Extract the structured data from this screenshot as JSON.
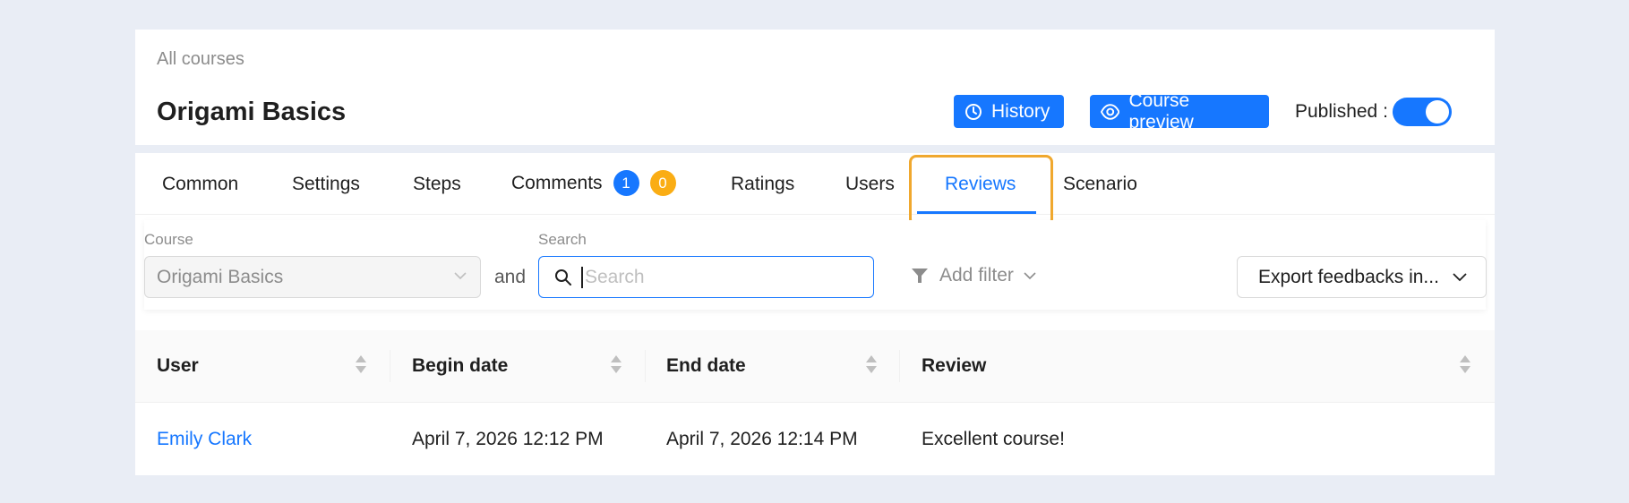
{
  "header": {
    "breadcrumb": "All courses",
    "title": "Origami Basics",
    "history_label": "History",
    "preview_label": "Course preview",
    "published_label": "Published :",
    "published": true
  },
  "tabs": [
    {
      "label": "Common"
    },
    {
      "label": "Settings"
    },
    {
      "label": "Steps"
    },
    {
      "label": "Comments",
      "badges": [
        "1",
        "0"
      ]
    },
    {
      "label": "Ratings"
    },
    {
      "label": "Users"
    },
    {
      "label": "Reviews",
      "active": true
    },
    {
      "label": "Scenario"
    }
  ],
  "filters": {
    "course_label": "Course",
    "course_value": "Origami Basics",
    "and_label": "and",
    "search_label": "Search",
    "search_placeholder": "Search",
    "search_value": "",
    "add_filter_label": "Add filter",
    "export_label": "Export feedbacks in..."
  },
  "table": {
    "columns": [
      "User",
      "Begin date",
      "End date",
      "Review"
    ],
    "rows": [
      {
        "user": "Emily Clark",
        "begin": "April 7, 2026 12:12 PM",
        "end": "April 7, 2026 12:14 PM",
        "review": "Excellent course!"
      }
    ]
  },
  "colors": {
    "accent": "#1677ff",
    "highlight": "#f0a82e",
    "badge_orange": "#faad14",
    "background": "#e9edf5"
  }
}
